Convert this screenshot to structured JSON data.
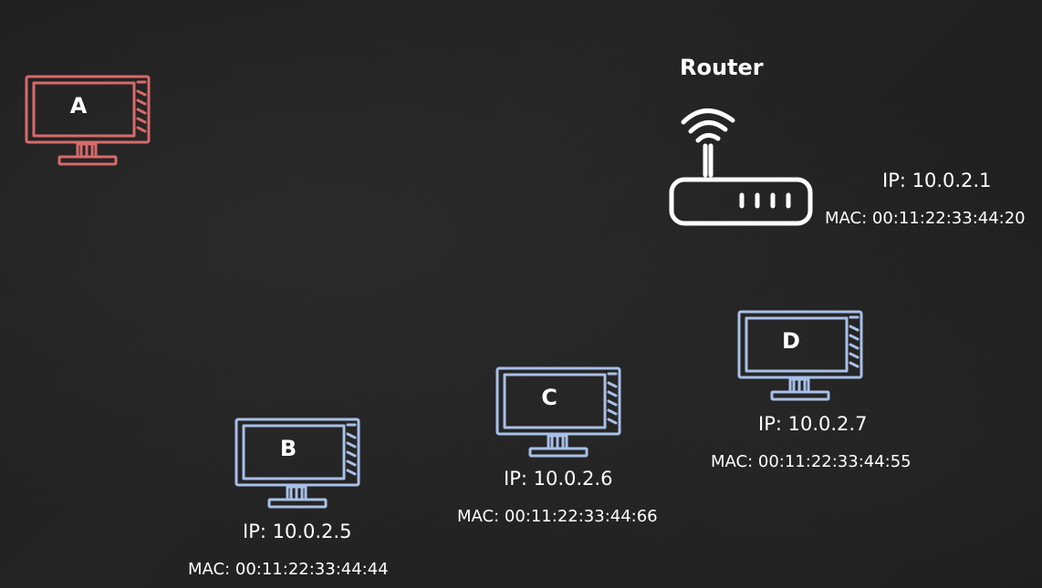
{
  "devices": {
    "a": {
      "name": "A",
      "color": "#d86a6a"
    },
    "b": {
      "name": "B",
      "ip": "IP: 10.0.2.5",
      "mac": "MAC: 00:11:22:33:44:44",
      "color": "#a8c0e8"
    },
    "c": {
      "name": "C",
      "ip": "IP: 10.0.2.6",
      "mac": "MAC: 00:11:22:33:44:66",
      "color": "#a8c0e8"
    },
    "d": {
      "name": "D",
      "ip": "IP: 10.0.2.7",
      "mac": "MAC: 00:11:22:33:44:55",
      "color": "#a8c0e8"
    }
  },
  "router": {
    "title": "Router",
    "ip": "IP: 10.0.2.1",
    "mac": "MAC: 00:11:22:33:44:20",
    "icon": "wifi-router-icon",
    "color": "#ffffff"
  },
  "background_color": "#212121"
}
